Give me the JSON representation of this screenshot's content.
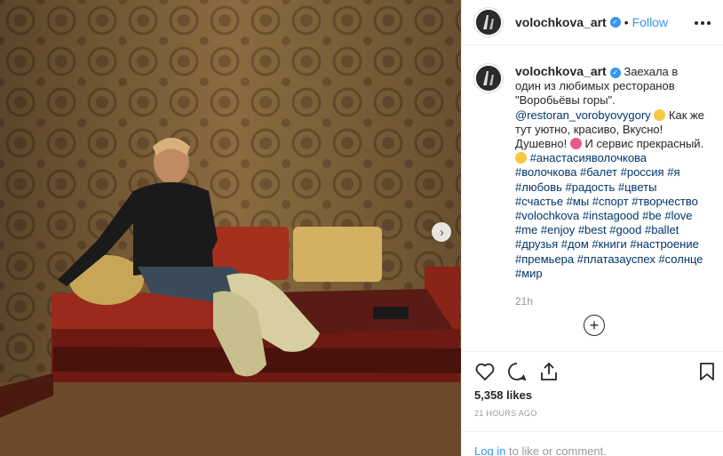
{
  "post": {
    "username": "volochkova_art",
    "follow_label": "Follow",
    "caption_text_1": "Заехала в один из любимых ресторанов \"Воробьёвы горы\".",
    "mention": "@restoran_vorobyovygory",
    "caption_text_2": "Как же тут уютно, красиво, Вкусно! Душевно!",
    "caption_text_3": "И сервис прекрасный.",
    "hashtags": "#анастасияволочкова #волочкова #балет #россия #я #любовь #радость #цветы #счастье #мы #спорт #творчество #volochkova #instagood #be #love #me #enjoy #best #good #ballet #друзья #дом #книги #настроение #премьера #платазауспех #солнце #мир",
    "relative_time": "21h",
    "likes": "5,358 likes",
    "posted_ago": "21 HOURS AGO"
  },
  "footer": {
    "login_link": "Log in",
    "login_text": " to like or comment."
  },
  "icons": {
    "like": "heart-icon",
    "comment": "comment-icon",
    "share": "share-icon",
    "save": "bookmark-icon"
  },
  "colors": {
    "link": "#3897f0",
    "hashtag": "#003569",
    "meta": "#999999"
  }
}
